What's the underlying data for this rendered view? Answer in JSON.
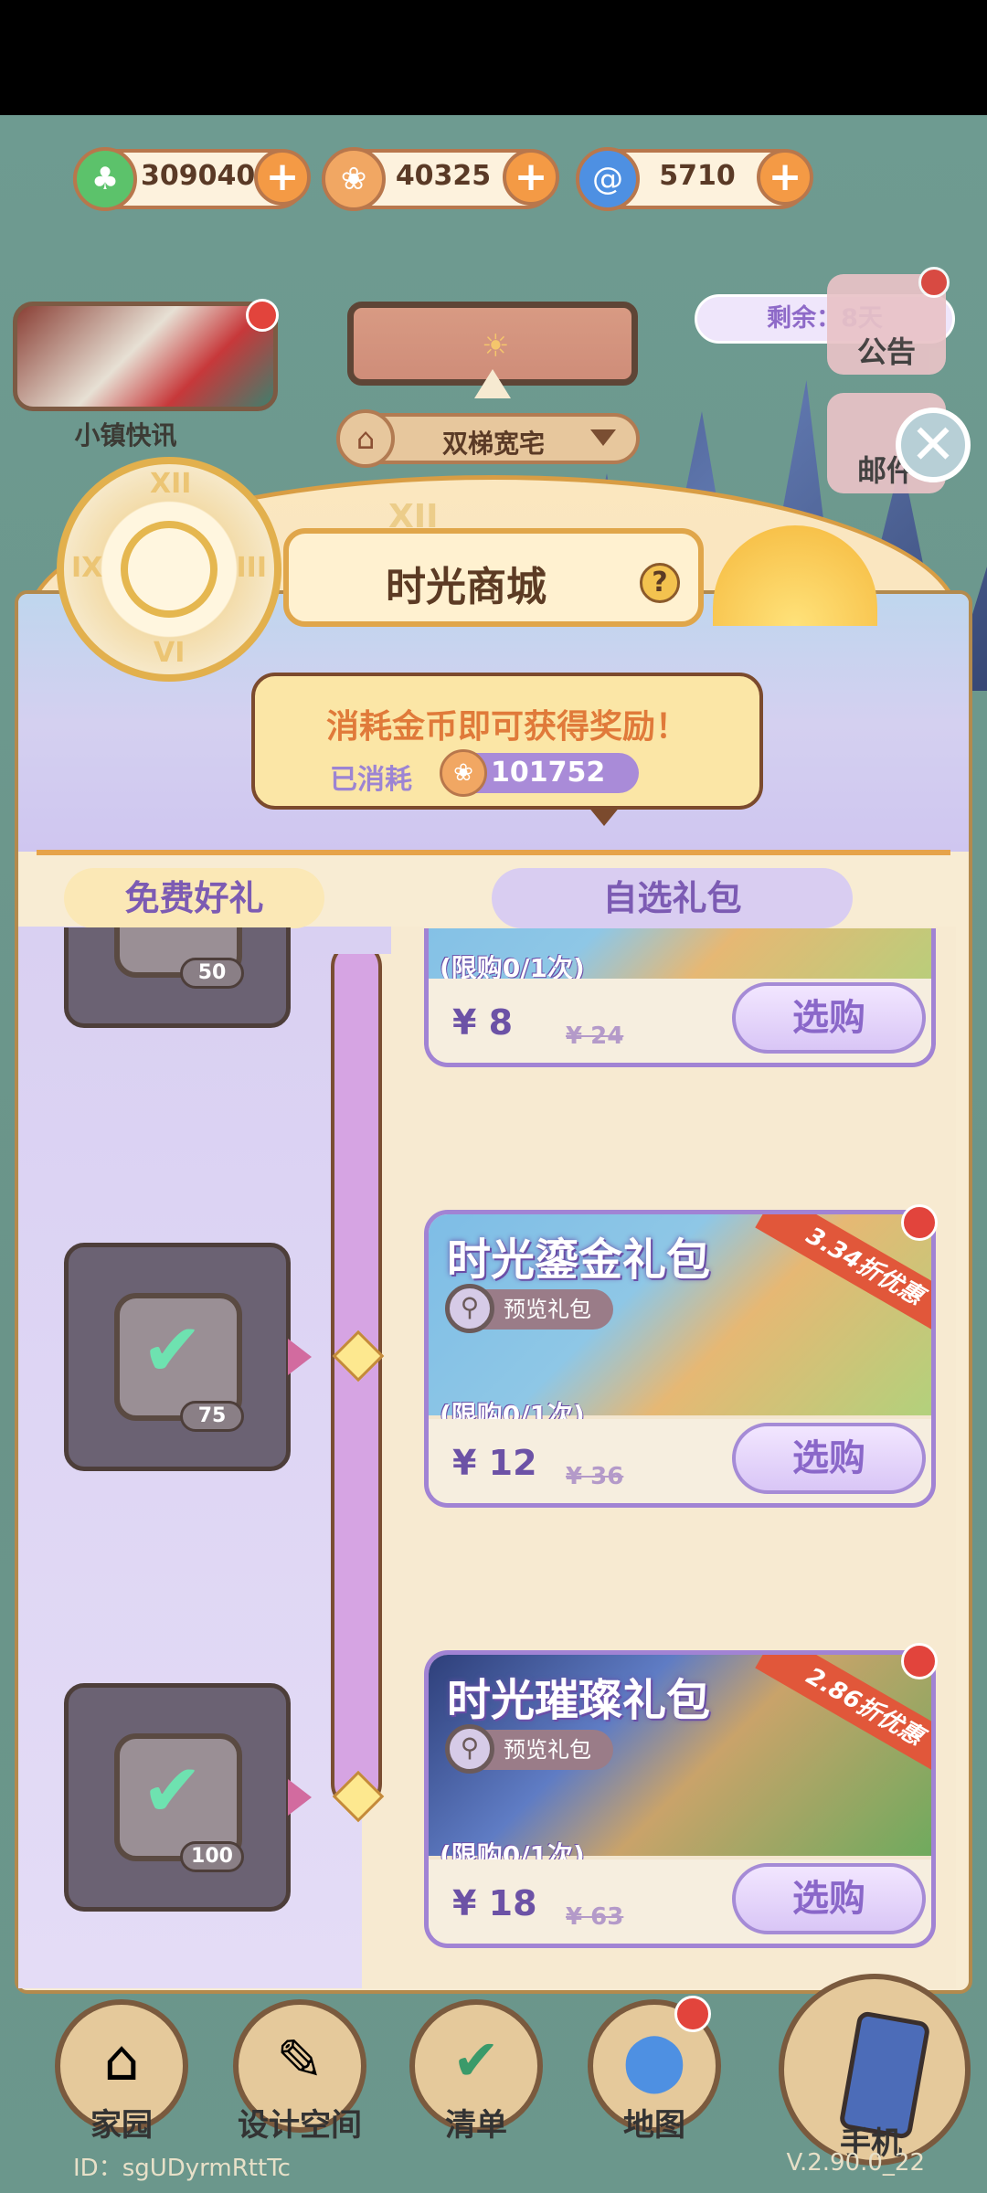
{
  "currencies": [
    {
      "icon": "clover-icon",
      "value": "309040",
      "color": "#5cc26b"
    },
    {
      "icon": "coin-icon",
      "value": "40325",
      "color": "#f1a763"
    },
    {
      "icon": "swirl-icon",
      "value": "5710",
      "color": "#4e90e2"
    }
  ],
  "news": {
    "label": "小镇快讯"
  },
  "house": {
    "name": "双梯宽宅"
  },
  "remaining": "剩余：8天",
  "side": {
    "announce": "公告",
    "mail": "邮件"
  },
  "shop": {
    "title": "时光商城",
    "clock_numerals": [
      "XII",
      "IX",
      "III",
      "VI"
    ],
    "arch_numeral": "XII",
    "notice": "消耗金币即可获得奖励！",
    "spent_label": "已消耗",
    "spent_value": "101752",
    "tab_free": "免费好礼",
    "tab_pack": "自选礼包"
  },
  "rewards": [
    {
      "count": "50"
    },
    {
      "count": "75"
    },
    {
      "count": "100"
    }
  ],
  "gifts": [
    {
      "title": "",
      "preview": "",
      "limit": "(限购0/1次)",
      "price": "¥ 8",
      "old_price": "¥ 24",
      "buy": "选购",
      "discount": ""
    },
    {
      "title": "时光鎏金礼包",
      "preview": "预览礼包",
      "limit": "(限购0/1次)",
      "price": "¥ 12",
      "old_price": "¥ 36",
      "buy": "选购",
      "discount": "3.34折优惠"
    },
    {
      "title": "时光璀璨礼包",
      "preview": "预览礼包",
      "limit": "(限购0/1次)",
      "price": "¥ 18",
      "old_price": "¥ 63",
      "buy": "选购",
      "discount": "2.86折优惠"
    }
  ],
  "nav": [
    {
      "label": "家园",
      "icon": "home-icon"
    },
    {
      "label": "设计空间",
      "icon": "design-icon"
    },
    {
      "label": "清单",
      "icon": "checklist-icon"
    },
    {
      "label": "地图",
      "icon": "map-pin-icon"
    },
    {
      "label": "手机",
      "icon": "phone-icon"
    }
  ],
  "footer": {
    "id": "ID：sgUDyrmRttTc",
    "version": "V.2.90.0_22"
  }
}
